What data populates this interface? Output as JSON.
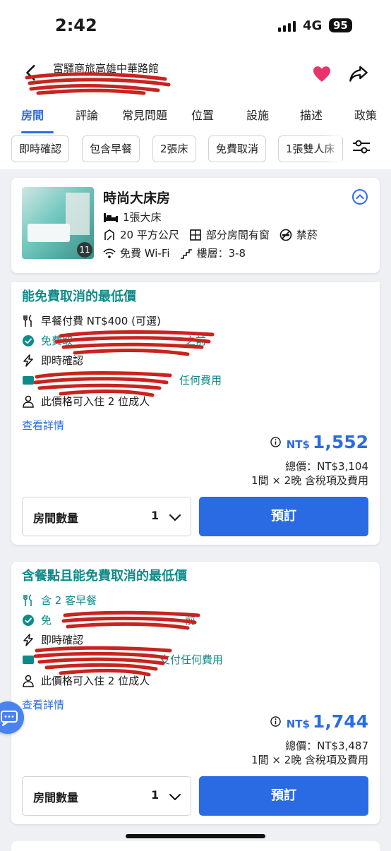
{
  "status_bar": {
    "time": "2:42",
    "network": "4G",
    "battery": "95"
  },
  "header": {
    "hotel_name": "富驛商旅高雄中華路館"
  },
  "tabs": [
    {
      "label": "房間",
      "active": true
    },
    {
      "label": "評論"
    },
    {
      "label": "常見問題"
    },
    {
      "label": "位置"
    },
    {
      "label": "設施"
    },
    {
      "label": "描述"
    },
    {
      "label": "政策"
    }
  ],
  "filters": [
    "即時確認",
    "包含早餐",
    "2張床",
    "免費取消",
    "1張雙人床"
  ],
  "room": {
    "title": "時尚大床房",
    "photo_count": "11",
    "bed": "1張大床",
    "size": "20 平方公尺",
    "window": "部分房間有窗",
    "smoking": "禁菸",
    "wifi": "免費 Wi-Fi",
    "floor": "樓層：3-8"
  },
  "rates": [
    {
      "title": "能免費取消的最低價",
      "breakfast": "早餐付費 NT$400 (可選)",
      "cancel_prefix": "免費取",
      "cancel_suffix": "之前",
      "instant": "即時確認",
      "payment": "任何費用",
      "occupancy": "此價格可入住 2 位成人",
      "details": "查看詳情",
      "currency": "NT$",
      "price": "1,552",
      "total": "總價：NT$3,104",
      "nights": "1間 × 2晚 含稅項及費用",
      "qty_label": "房間數量",
      "qty_value": "1",
      "book": "預訂"
    },
    {
      "title": "含餐點且能免費取消的最低價",
      "breakfast": "含 2 客早餐",
      "cancel_prefix": "免",
      "cancel_suffix": "前",
      "instant": "即時確認",
      "payment": "支付任何費用",
      "occupancy": "此價格可入住 2 位成人",
      "details": "查看詳情",
      "currency": "NT$",
      "price": "1,744",
      "total": "總價：NT$3,487",
      "nights": "1間 × 2晚 含稅項及費用",
      "qty_label": "房間數量",
      "qty_value": "1",
      "book": "預訂"
    }
  ],
  "colors": {
    "accent": "#2a6be3",
    "teal": "#0f8a8a",
    "heart": "#e8336d",
    "redaction": "#c9231f"
  }
}
